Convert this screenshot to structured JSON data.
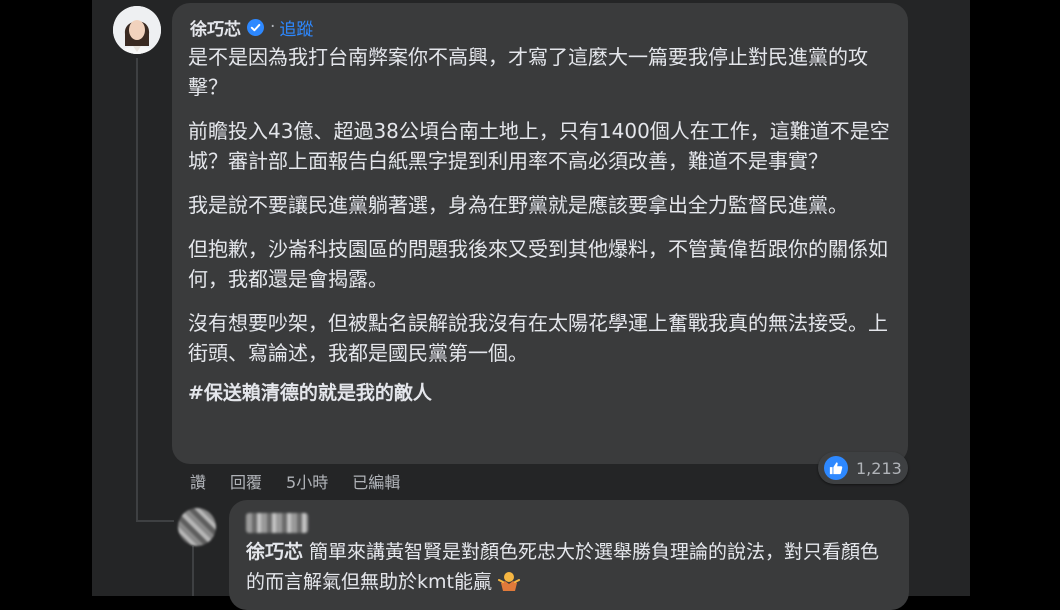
{
  "post": {
    "author": "徐巧芯",
    "separator": "·",
    "follow_label": "追蹤",
    "paragraphs": [
      "是不是因為我打台南弊案你不高興，才寫了這麼大一篇要我停止對民進黨的攻擊？",
      "前瞻投入43億、超過38公頃台南土地上，只有1400個人在工作，這難道不是空城？審計部上面報告白紙黑字提到利用率不高必須改善，難道不是事實？",
      "我是說不要讓民進黨躺著選，身為在野黨就是應該要拿出全力監督民進黨。",
      "但抱歉，沙崙科技園區的問題我後來又受到其他爆料，不管黃偉哲跟你的關係如何，我都還是會揭露。",
      "沒有想要吵架，但被點名誤解說我沒有在太陽花學運上奮戰我真的無法接受。上街頭、寫論述，我都是國民黨第一個。"
    ],
    "hashtag": "#保送賴清德的就是我的敵人",
    "actions": {
      "read": "讚",
      "reply": "回覆",
      "time": "5小時",
      "edited": "已編輯"
    },
    "reaction_count": "1,213",
    "reaction_icon": "like-icon",
    "accent_color": "#2d88ff"
  },
  "reply": {
    "mention": "徐巧芯",
    "text": " 簡單來講黃智賢是對顏色死忠大於選舉勝負理論的說法，對只看顏色的而言解氣但無助於kmt能贏"
  }
}
